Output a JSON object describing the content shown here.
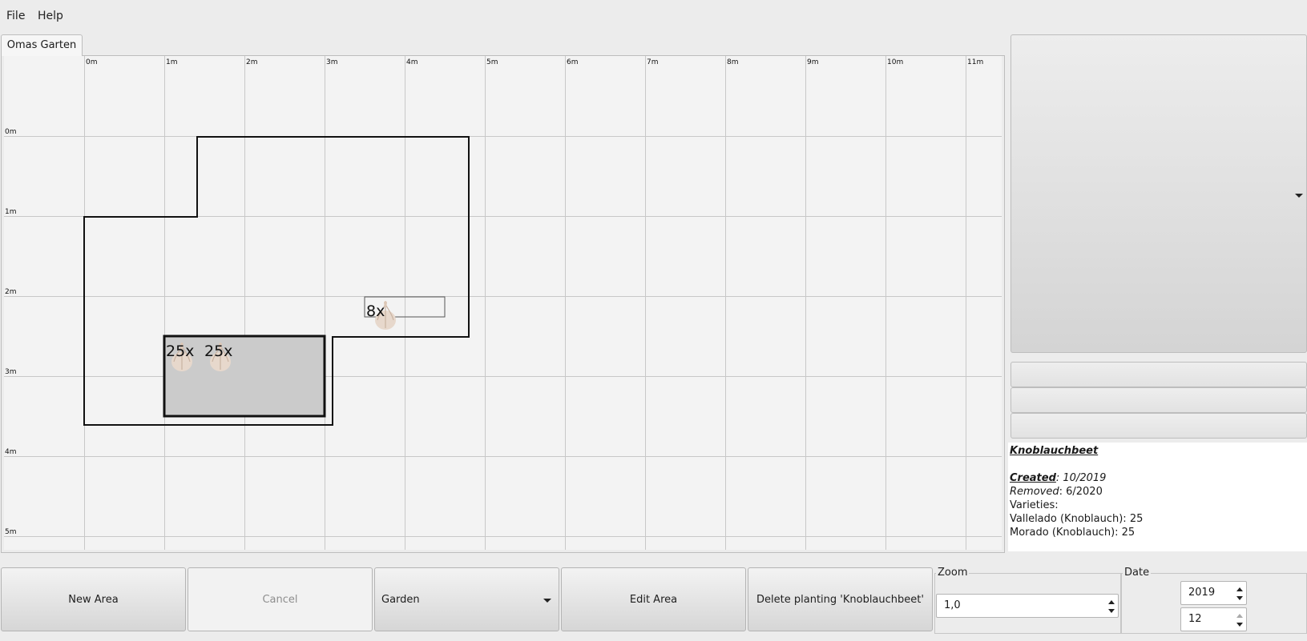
{
  "menu": {
    "file": "File",
    "help": "Help"
  },
  "tabs": [
    {
      "label": "Omas Garten"
    }
  ],
  "canvas": {
    "x_labels": [
      "0m",
      "1m",
      "2m",
      "3m",
      "4m",
      "5m",
      "6m",
      "7m",
      "8m",
      "9m",
      "10m",
      "11m"
    ],
    "y_labels": [
      "0m",
      "1m",
      "2m",
      "3m",
      "4m",
      "5m"
    ],
    "plantings": [
      {
        "count": "25x",
        "icon": "garlic-icon"
      },
      {
        "count": "25x",
        "icon": "garlic-icon"
      },
      {
        "count": "8x",
        "icon": "garlic-icon"
      }
    ]
  },
  "info": {
    "title": "Knoblauchbeet",
    "created_label": "Created",
    "created_value": "10/2019",
    "removed_label": "Removed",
    "removed_value": "6/2020",
    "varieties_label": "Varieties:",
    "varieties": [
      "Vallelado (Knoblauch): 25",
      "Morado (Knoblauch): 25"
    ]
  },
  "toolbar": {
    "new_area": "New Area",
    "cancel": "Cancel",
    "garden_select": "Garden",
    "edit_area": "Edit Area",
    "delete_planting": "Delete planting 'Knoblauchbeet'"
  },
  "zoom": {
    "label": "Zoom",
    "value": "1,0"
  },
  "date": {
    "label": "Date",
    "year": "2019",
    "month": "12"
  }
}
